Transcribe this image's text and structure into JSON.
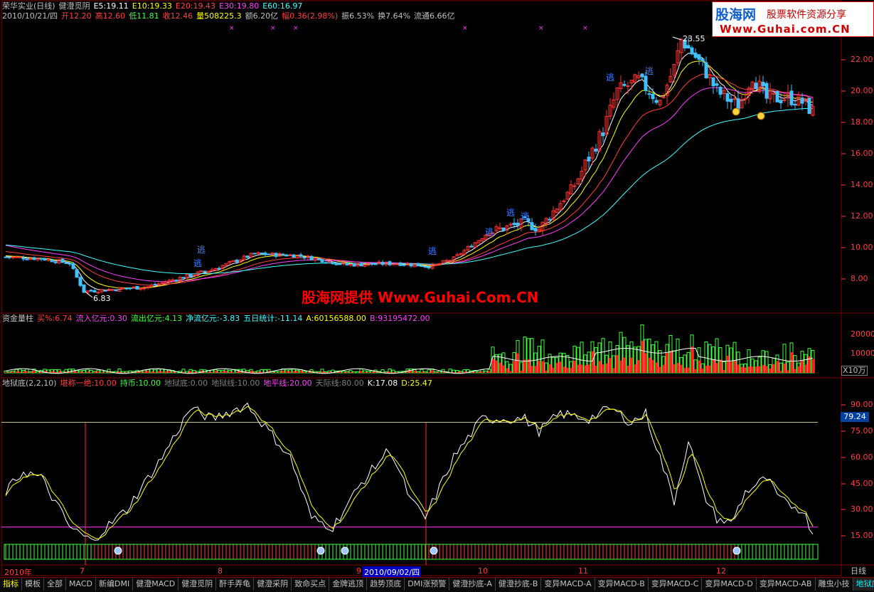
{
  "header": {
    "line1": [
      {
        "text": "荣华实业(日线)",
        "color": "#c0c0c0"
      },
      {
        "text": "健澄觅阴",
        "color": "#c0c0c0"
      },
      {
        "text": "E5:19.11",
        "color": "#ffffff"
      },
      {
        "text": "E10:19.33",
        "color": "#ffff00"
      },
      {
        "text": "E20:19.43",
        "color": "#ff4040"
      },
      {
        "text": "E30:19.80",
        "color": "#ff40ff"
      },
      {
        "text": "E60:16.97",
        "color": "#40ffff"
      }
    ],
    "line2": [
      {
        "text": "2010/10/21/四",
        "color": "#c0c0c0"
      },
      {
        "text": "开12.20",
        "color": "#ff4040"
      },
      {
        "text": "高12.60",
        "color": "#ff4040"
      },
      {
        "text": "低11.81",
        "color": "#40ff40"
      },
      {
        "text": "收12.46",
        "color": "#ff4040"
      },
      {
        "text": "量508225.3",
        "color": "#ffff00"
      },
      {
        "text": "额6.20亿",
        "color": "#c0c0c0"
      },
      {
        "text": "幅0.36(2.98%)",
        "color": "#ff4040"
      },
      {
        "text": "振6.53%",
        "color": "#c0c0c0"
      },
      {
        "text": "换7.64%",
        "color": "#c0c0c0"
      },
      {
        "text": "流通6.66亿",
        "color": "#c0c0c0"
      }
    ]
  },
  "logo": {
    "brand": "股海网",
    "slogan": "股票软件资源分享",
    "url": "Www.Guhai.com.CN"
  },
  "watermark": "股海网提供 Www.Guhai.Com.CN",
  "price_axis": [
    "22.00",
    "20.00",
    "18.00",
    "16.00",
    "14.00",
    "12.00",
    "10.00",
    "8.00"
  ],
  "price_annotations": {
    "high": "23.55",
    "low": "6.83",
    "escape_label": "逃"
  },
  "volume_header": [
    {
      "text": "资金量柱",
      "color": "#c0c0c0"
    },
    {
      "text": "买%:6.74",
      "color": "#ff4040"
    },
    {
      "text": "流入亿元:0.30",
      "color": "#ff40ff"
    },
    {
      "text": "流出亿元:4.13",
      "color": "#40ff40"
    },
    {
      "text": "净流亿元:-3.83",
      "color": "#40ffff"
    },
    {
      "text": "五日统计:-11.14",
      "color": "#40ffff"
    },
    {
      "text": "A:60156588.00",
      "color": "#ffff00"
    },
    {
      "text": "B:93195472.00",
      "color": "#ff40ff"
    }
  ],
  "volume_axis": [
    "20000",
    "10000"
  ],
  "volume_unit": "X10万",
  "kd_header": [
    {
      "text": "地狱底(2,2,10)",
      "color": "#c0c0c0"
    },
    {
      "text": "堪称一绝:10.00",
      "color": "#ff4040"
    },
    {
      "text": "持币:10.00",
      "color": "#40ff40"
    },
    {
      "text": "地狱底:0.00",
      "color": "#808080"
    },
    {
      "text": "地狱线:10.00",
      "color": "#808080"
    },
    {
      "text": "地平线:20.00",
      "color": "#ff40ff"
    },
    {
      "text": "天际线:80.00",
      "color": "#808080"
    },
    {
      "text": "K:17.08",
      "color": "#ffffff"
    },
    {
      "text": "D:25.47",
      "color": "#ffff00"
    }
  ],
  "kd_axis": [
    "90.00",
    "75.00",
    "60.00",
    "45.00",
    "30.00",
    "15.00"
  ],
  "kd_current": "79.24",
  "date_axis": [
    "2010年",
    "7",
    "8",
    "9",
    "10",
    "11",
    "12"
  ],
  "date_highlight": "2010/09/02/四",
  "period_label": "日线",
  "tabs": [
    "指标",
    "模板",
    "全部",
    "MACD",
    "新编DMI",
    "健澄MACD",
    "健澄觅阴",
    "酐手弄龟",
    "健澄采阴",
    "致命买点",
    "金牌逃顶",
    "趋势顶底",
    "DMI涨预警",
    "健澄抄底-A",
    "健澄抄底-B",
    "变异MACD-A",
    "变异MACD-B",
    "变异MACD-C",
    "变异MACD-D",
    "变异MACD-AB",
    "雕虫小技",
    "地狱底"
  ],
  "colors": {
    "up": "#ff3232",
    "down": "#40c0ff",
    "ma5": "#ffffff",
    "ma10": "#ffff00",
    "ma20": "#ff4040",
    "ma30": "#ff40ff",
    "ma60": "#40ffff",
    "grid": "#800000"
  }
}
